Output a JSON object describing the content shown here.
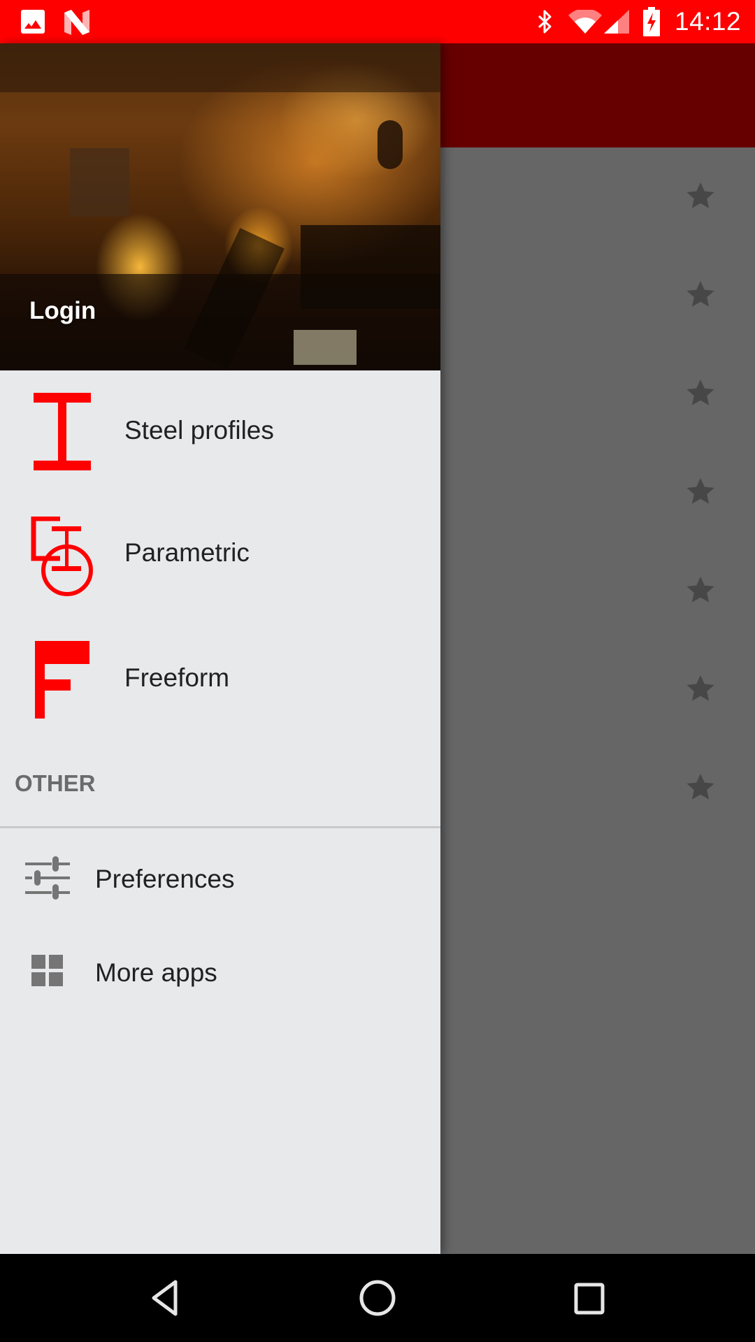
{
  "status_bar": {
    "time": "14:12",
    "left_icons": [
      "gallery-notification-icon",
      "n-app-notification-icon"
    ],
    "right_icons": [
      "bluetooth-icon",
      "wifi-icon",
      "cellular-signal-icon",
      "battery-charging-icon"
    ],
    "background_color": "#ff0000"
  },
  "app_bar": {
    "background_color": "#660000"
  },
  "content": {
    "favorite_stars": 7
  },
  "drawer": {
    "header": {
      "login_label": "Login"
    },
    "items": [
      {
        "label": "Steel profiles",
        "icon": "i-beam-icon",
        "icon_color": "#ff0000"
      },
      {
        "label": "Parametric",
        "icon": "parametric-icon",
        "icon_color": "#ff0000"
      },
      {
        "label": "Freeform",
        "icon": "freeform-f-icon",
        "icon_color": "#ff0000"
      }
    ],
    "section_header": "OTHER",
    "other_items": [
      {
        "label": "Preferences",
        "icon": "sliders-icon"
      },
      {
        "label": "More apps",
        "icon": "grid-icon"
      }
    ],
    "background_color": "#e8e9eb"
  },
  "nav_bar": {
    "buttons": [
      "back",
      "home",
      "recents"
    ]
  }
}
